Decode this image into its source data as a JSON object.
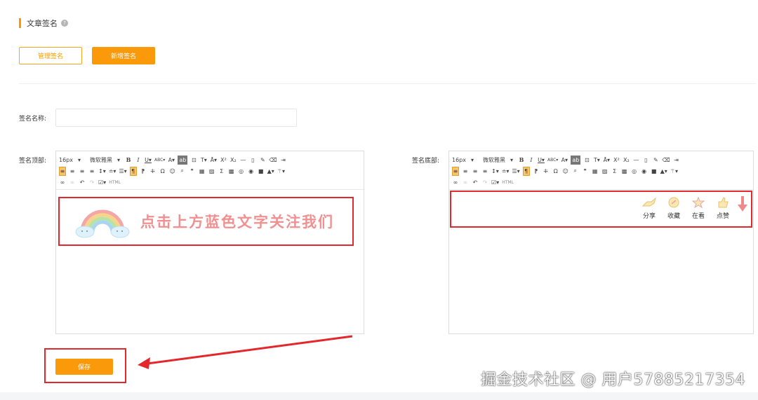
{
  "section": {
    "title": "文章签名",
    "help": "?"
  },
  "buttons": {
    "manage": "管理签名",
    "add": "新增签名"
  },
  "form": {
    "name_label": "签名名称:",
    "name_value": "",
    "top_label": "签名顶部:",
    "bottom_label": "签名底部:"
  },
  "toolbar": {
    "font_size": "16px",
    "font_family": "微软雅黑",
    "html_label": "HTML"
  },
  "top_signature": {
    "text": "点击上方蓝色文字关注我们"
  },
  "bottom_signature": {
    "actions": [
      {
        "label": "分享",
        "icon": "share-hand-icon"
      },
      {
        "label": "收藏",
        "icon": "collect-icon"
      },
      {
        "label": "在看",
        "icon": "watching-icon"
      },
      {
        "label": "点赞",
        "icon": "like-icon"
      }
    ]
  },
  "save": {
    "label": "保存"
  },
  "watermark": "掘金技术社区 @ 用户57885217354",
  "colors": {
    "accent": "#fa9a0a",
    "highlight": "#e2282d"
  }
}
